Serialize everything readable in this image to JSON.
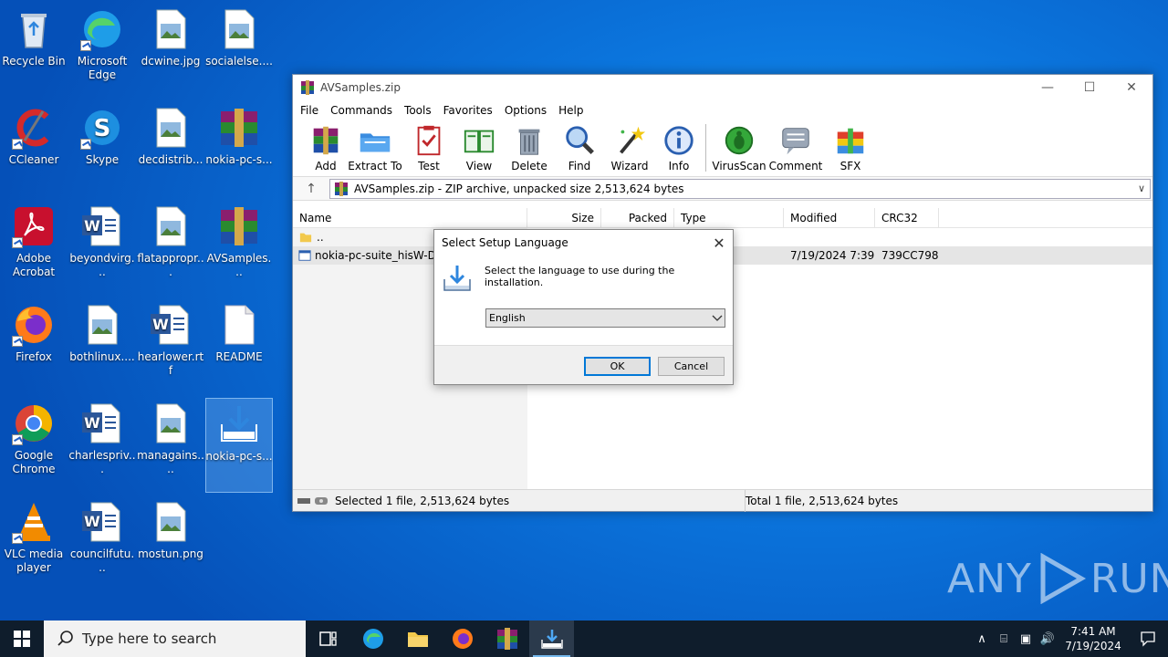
{
  "desktop": {
    "icons": [
      {
        "label": "Recycle Bin"
      },
      {
        "label": "Microsoft Edge"
      },
      {
        "label": "dcwine.jpg"
      },
      {
        "label": "socialelse...."
      },
      {
        "label": "CCleaner"
      },
      {
        "label": "Skype"
      },
      {
        "label": "decdistrib..."
      },
      {
        "label": "nokia-pc-s..."
      },
      {
        "label": "Adobe Acrobat"
      },
      {
        "label": "beyondvirg..."
      },
      {
        "label": "flatappropr..."
      },
      {
        "label": "AVSamples..."
      },
      {
        "label": "Firefox"
      },
      {
        "label": "bothlinux...."
      },
      {
        "label": "hearlower.rtf"
      },
      {
        "label": "README"
      },
      {
        "label": "Google Chrome"
      },
      {
        "label": "charlespriv..."
      },
      {
        "label": "managains...."
      },
      {
        "label": "nokia-pc-s..."
      },
      {
        "label": "VLC media player"
      },
      {
        "label": "councilfutu..."
      },
      {
        "label": "mostun.png"
      }
    ]
  },
  "winrar": {
    "title": "AVSamples.zip",
    "menu": [
      "File",
      "Commands",
      "Tools",
      "Favorites",
      "Options",
      "Help"
    ],
    "toolbar": [
      "Add",
      "Extract To",
      "Test",
      "View",
      "Delete",
      "Find",
      "Wizard",
      "Info",
      "VirusScan",
      "Comment",
      "SFX"
    ],
    "address": "AVSamples.zip - ZIP archive, unpacked size 2,513,624 bytes",
    "columns": [
      "Name",
      "Size",
      "Packed",
      "Type",
      "Modified",
      "CRC32"
    ],
    "rows": [
      {
        "name": "..",
        "size": "",
        "packed": "",
        "type": "",
        "modified": "",
        "crc": ""
      },
      {
        "name": "nokia-pc-suite_hisW-D1.",
        "size": "",
        "packed": "",
        "type": "",
        "modified": "7/19/2024 7:39 ...",
        "crc": "739CC798"
      }
    ],
    "status_left": "Selected 1 file, 2,513,624 bytes",
    "status_right": "Total 1 file, 2,513,624 bytes"
  },
  "dialog": {
    "title": "Select Setup Language",
    "message": "Select the language to use during the installation.",
    "selected_language": "English",
    "ok_label": "OK",
    "cancel_label": "Cancel"
  },
  "taskbar": {
    "search_placeholder": "Type here to search",
    "time": "7:41 AM",
    "date": "7/19/2024"
  },
  "watermark": {
    "left": "ANY",
    "right": "RUN"
  },
  "colors": {
    "desktop": "#0b74dc",
    "taskbar": "#0f1d2c",
    "accent": "#0078d7"
  }
}
